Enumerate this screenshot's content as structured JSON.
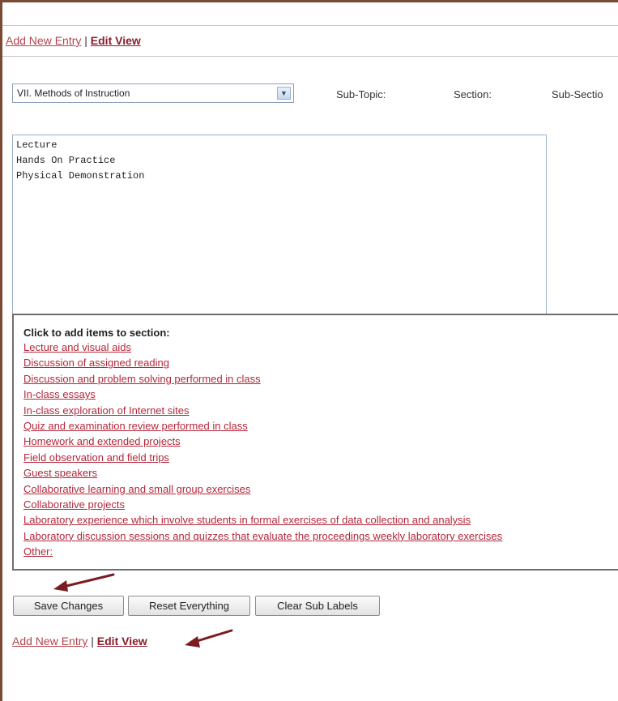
{
  "top_nav": {
    "add_new_entry": "Add New Entry",
    "separator": "|",
    "edit_view": "Edit View"
  },
  "topic_select": {
    "value": "VII. Methods of Instruction"
  },
  "headers": {
    "sub_topic": "Sub-Topic:",
    "section": "Section:",
    "sub_section": "Sub-Sectio"
  },
  "section_text": [
    "Lecture",
    "Hands On Practice",
    "Physical Demonstration"
  ],
  "items_panel": {
    "title": "Click to add items to section:",
    "items": [
      "Lecture and visual aids",
      "Discussion of assigned reading",
      "Discussion and problem solving performed in class",
      "In-class essays",
      "In-class exploration of Internet sites",
      "Quiz and examination review performed in class",
      "Homework and extended projects",
      "Field observation and field trips",
      "Guest speakers",
      "Collaborative learning and small group exercises",
      "Collaborative projects",
      "Laboratory experience which involve students in formal exercises of data collection and analysis",
      "Laboratory discussion sessions and quizzes that evaluate the proceedings weekly laboratory exercises",
      "Other:"
    ]
  },
  "buttons": {
    "save": "Save Changes",
    "reset": "Reset Everything",
    "clear": "Clear Sub Labels"
  },
  "bottom_nav": {
    "add_new_entry": "Add New Entry",
    "separator": "|",
    "edit_view": "Edit View"
  },
  "colors": {
    "link": "#b3273a",
    "link_strong": "#8b1c2c",
    "frame": "#7a4a36",
    "arrow": "#7b1c22"
  }
}
